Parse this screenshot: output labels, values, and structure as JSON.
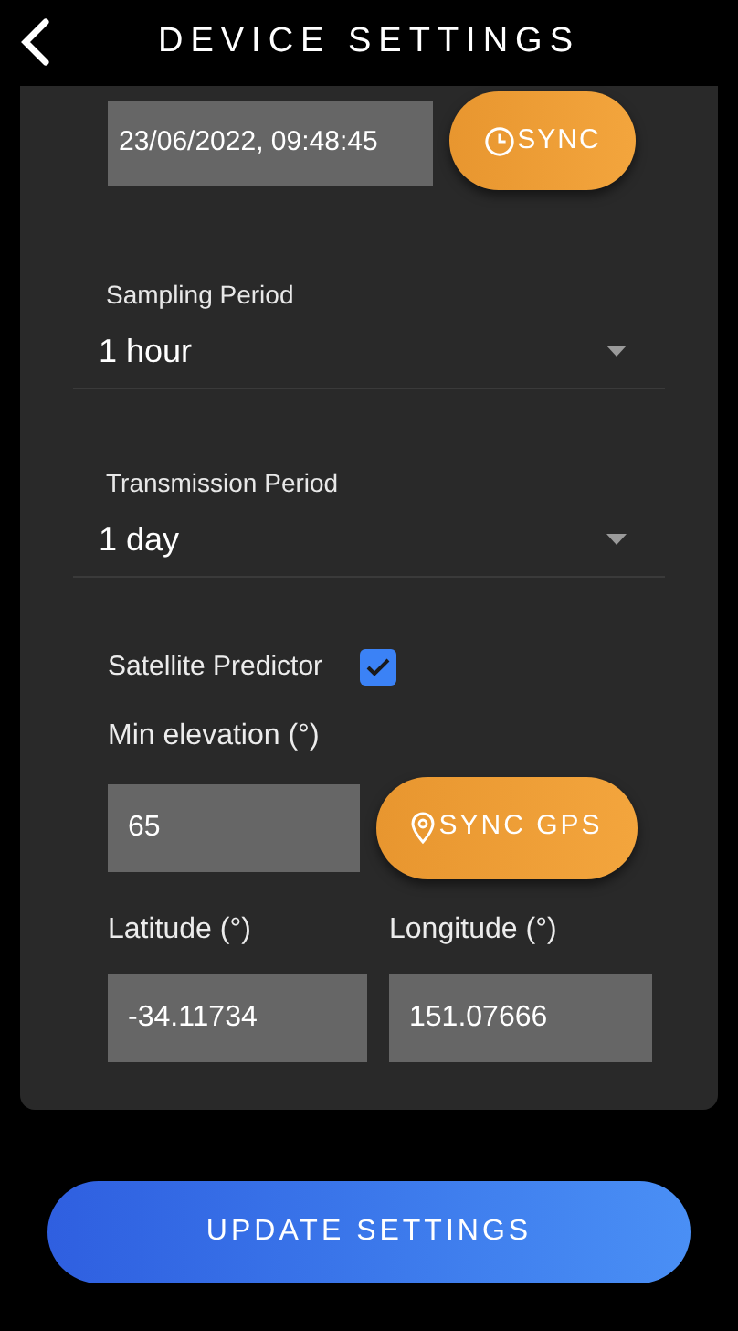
{
  "header": {
    "title": "DEVICE SETTINGS"
  },
  "clock": {
    "value": "23/06/2022, 09:48:45",
    "button": "SYNC"
  },
  "selects": [
    {
      "label": "Sampling Period",
      "value": "1 hour"
    },
    {
      "label": "Transmission Period",
      "value": "1 day"
    }
  ],
  "satellite_predictor": {
    "label": "Satellite Predictor",
    "checked": true
  },
  "min_elevation": {
    "label": "Min elevation (°)",
    "value": "65",
    "button": "SYNC GPS"
  },
  "coordinates": [
    {
      "label": "Latitude (°)",
      "value": "-34.11734"
    },
    {
      "label": "Longitude (°)",
      "value": "151.07666"
    }
  ],
  "update_button": "UPDATE SETTINGS"
}
